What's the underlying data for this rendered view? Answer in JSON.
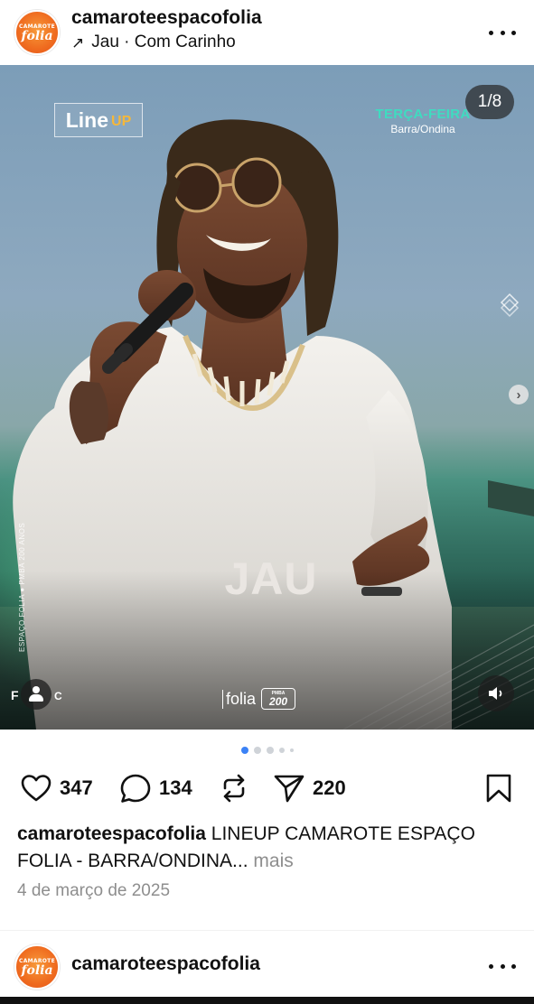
{
  "post": {
    "username": "camaroteespacofolia",
    "avatar_text_top": "CAMAROTE",
    "avatar_text_main": "folia",
    "music_arrow": "↗",
    "music": "Jau · Com Carinho",
    "more_icon": "more-horizontal-icon"
  },
  "media": {
    "badge_line": "Line",
    "badge_up": "UP",
    "counter": "1/8",
    "day": "TERÇA-FEIRA",
    "place": "Barra/Ondina",
    "artist": "JAU",
    "vertical_text": "ESPAÇO FOLIA ● PMBA 200 ANOS",
    "logo_folia": "folia",
    "pmba_top": "PMBA",
    "pmba_num": "200",
    "corner_left": "F",
    "corner_right": "C",
    "colors": {
      "day": "#3fdcc0",
      "badge_up": "#f5b73a",
      "title": "#eae6e2"
    }
  },
  "carousel": {
    "total_dots": 5,
    "active_index": 0,
    "active_color": "#3b82f6"
  },
  "actions": {
    "likes": "347",
    "comments": "134",
    "shares": "220"
  },
  "caption": {
    "username": "camaroteespacofolia",
    "text": "LINEUP CAMAROTE ESPAÇO FOLIA - BARRA/ONDINA...",
    "more": "mais"
  },
  "date": "4 de março de 2025",
  "next_post": {
    "username": "camaroteespacofolia"
  }
}
